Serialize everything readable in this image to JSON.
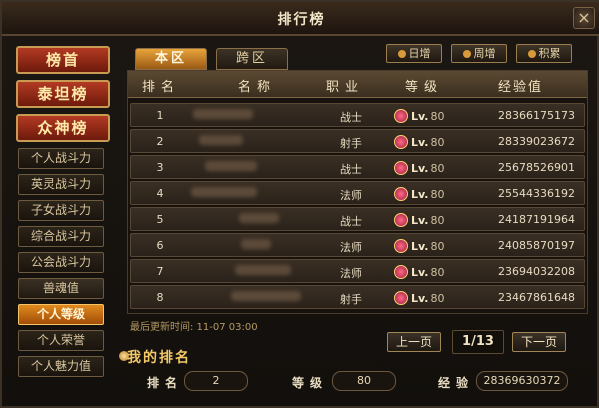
{
  "window": {
    "title": "排行榜",
    "close_label": "×"
  },
  "nav": {
    "big": [
      "榜首",
      "泰坦榜",
      "众神榜"
    ],
    "small": [
      "个人战斗力",
      "英灵战斗力",
      "子女战斗力",
      "综合战斗力",
      "公会战斗力",
      "兽魂值",
      "个人等级",
      "个人荣誉",
      "个人魅力值"
    ],
    "active": "个人等级"
  },
  "tabs": {
    "local": "本区",
    "cross": "跨区"
  },
  "period": {
    "day": "日增",
    "week": "周增",
    "total": "积累"
  },
  "table": {
    "headers": {
      "rank": "排名",
      "name": "名称",
      "job": "职业",
      "level": "等级",
      "exp": "经验值"
    },
    "rows": [
      {
        "rank": "1",
        "job": "战士",
        "lv_prefix": "Lv.",
        "lv": "80",
        "exp": "28366175173"
      },
      {
        "rank": "2",
        "job": "射手",
        "lv_prefix": "Lv.",
        "lv": "80",
        "exp": "28339023672"
      },
      {
        "rank": "3",
        "job": "战士",
        "lv_prefix": "Lv.",
        "lv": "80",
        "exp": "25678526901"
      },
      {
        "rank": "4",
        "job": "法师",
        "lv_prefix": "Lv.",
        "lv": "80",
        "exp": "25544336192"
      },
      {
        "rank": "5",
        "job": "战士",
        "lv_prefix": "Lv.",
        "lv": "80",
        "exp": "24187191964"
      },
      {
        "rank": "6",
        "job": "法师",
        "lv_prefix": "Lv.",
        "lv": "80",
        "exp": "24085870197"
      },
      {
        "rank": "7",
        "job": "法师",
        "lv_prefix": "Lv.",
        "lv": "80",
        "exp": "23694032208"
      },
      {
        "rank": "8",
        "job": "射手",
        "lv_prefix": "Lv.",
        "lv": "80",
        "exp": "23467861648"
      }
    ]
  },
  "update_text": "最后更新时间: 11-07 03:00",
  "pager": {
    "prev": "上一页",
    "next": "下一页",
    "indicator": "1/13"
  },
  "my_rank": {
    "title": "我的排名",
    "rank_label": "排名",
    "rank_value": "2",
    "level_label": "等级",
    "level_value": "80",
    "exp_label": "经验",
    "exp_value": "28369630372"
  }
}
